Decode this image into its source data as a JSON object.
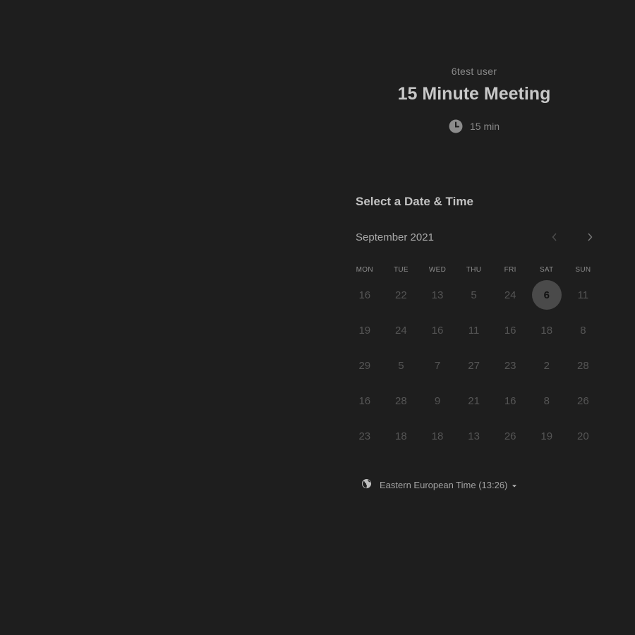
{
  "header": {
    "host_name": "6test user",
    "event_title": "15 Minute Meeting",
    "duration": "15 min",
    "duration_icon": "clock-icon"
  },
  "calendar": {
    "section_title": "Select a Date & Time",
    "month_label": "September 2021",
    "prev_icon": "chevron-left-icon",
    "next_icon": "chevron-right-icon",
    "weekdays": [
      "MON",
      "TUE",
      "WED",
      "THU",
      "FRI",
      "SAT",
      "SUN"
    ],
    "weeks": [
      [
        "16",
        "22",
        "13",
        "5",
        "24",
        "6",
        "11"
      ],
      [
        "19",
        "24",
        "16",
        "11",
        "16",
        "18",
        "8"
      ],
      [
        "29",
        "5",
        "7",
        "27",
        "23",
        "2",
        "28"
      ],
      [
        "16",
        "28",
        "9",
        "21",
        "16",
        "8",
        "26"
      ],
      [
        "23",
        "18",
        "18",
        "13",
        "26",
        "19",
        "20"
      ]
    ],
    "selected_day": "6"
  },
  "timezone": {
    "icon": "globe-icon",
    "label": "Eastern European Time (13:26)",
    "caret_icon": "caret-down-icon"
  },
  "colors": {
    "background": "#1e1e1e",
    "selected_day_bg": "#4a4a4a",
    "muted_day": "#555555"
  }
}
